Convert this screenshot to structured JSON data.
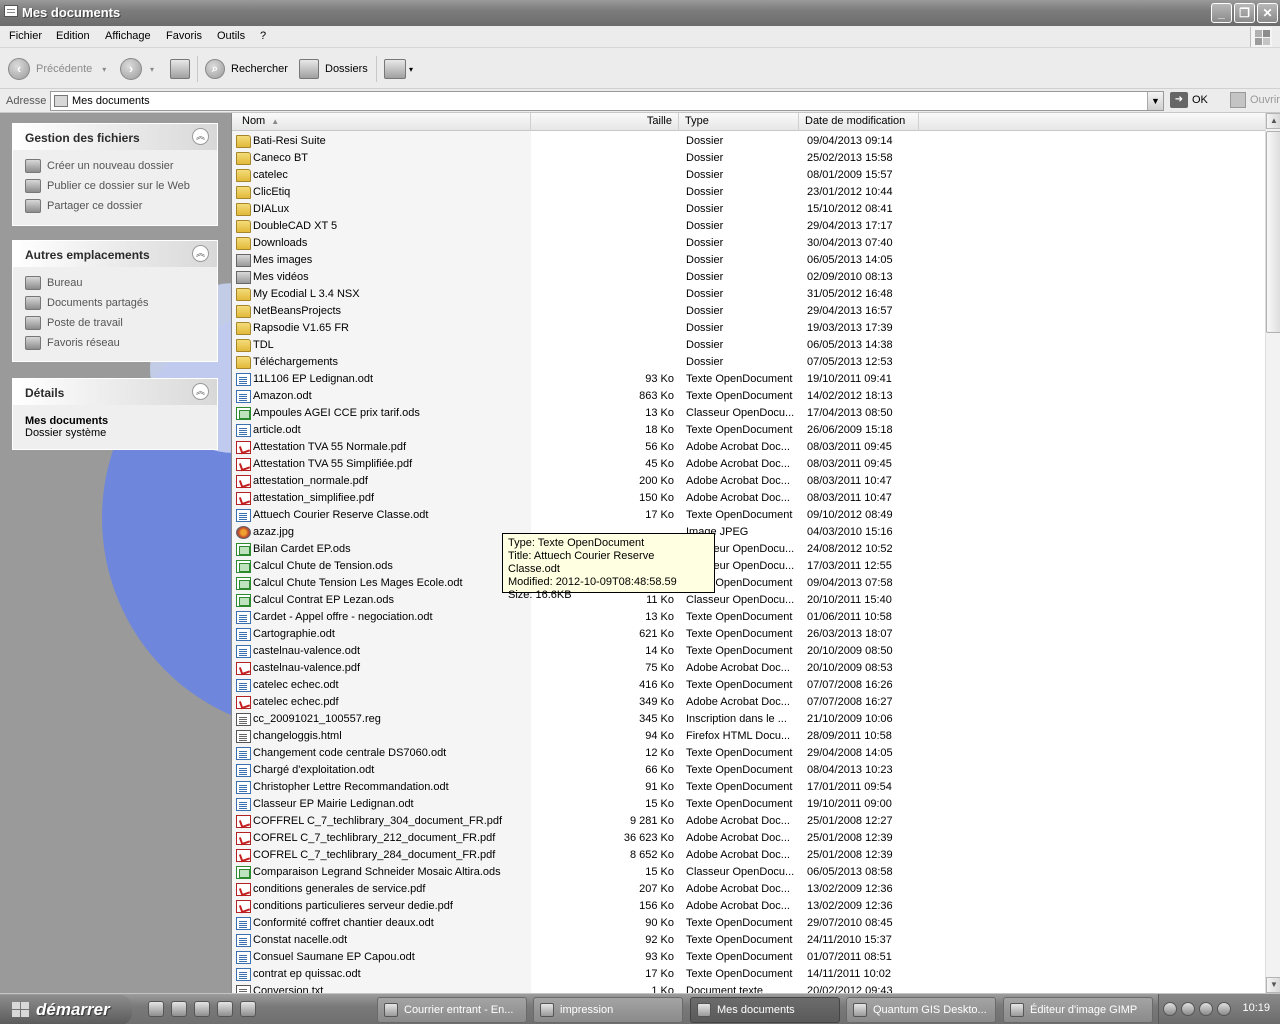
{
  "window": {
    "title": "Mes documents"
  },
  "menu": [
    "Fichier",
    "Edition",
    "Affichage",
    "Favoris",
    "Outils",
    "?"
  ],
  "toolbar": {
    "back": "Précédente",
    "search": "Rechercher",
    "folders": "Dossiers"
  },
  "address": {
    "label": "Adresse",
    "value": "Mes documents",
    "go": "OK",
    "open": "Ouvrir"
  },
  "left_panels": {
    "file_tasks": {
      "title": "Gestion des fichiers",
      "links": [
        "Créer un nouveau dossier",
        "Publier ce dossier sur le Web",
        "Partager ce dossier"
      ]
    },
    "other_places": {
      "title": "Autres emplacements",
      "links": [
        "Bureau",
        "Documents partagés",
        "Poste de travail",
        "Favoris réseau"
      ]
    },
    "details": {
      "title": "Détails",
      "name": "Mes documents",
      "desc": "Dossier système"
    }
  },
  "columns": {
    "name": "Nom",
    "size": "Taille",
    "type": "Type",
    "date": "Date de modification"
  },
  "files": [
    {
      "icon": "folder-icon",
      "name": "Bati-Resi Suite",
      "size": "",
      "type": "Dossier",
      "date": "09/04/2013 09:14"
    },
    {
      "icon": "folder-icon",
      "name": "Caneco BT",
      "size": "",
      "type": "Dossier",
      "date": "25/02/2013 15:58"
    },
    {
      "icon": "folder-icon",
      "name": "catelec",
      "size": "",
      "type": "Dossier",
      "date": "08/01/2009 15:57"
    },
    {
      "icon": "folder-icon",
      "name": "ClicEtiq",
      "size": "",
      "type": "Dossier",
      "date": "23/01/2012 10:44"
    },
    {
      "icon": "folder-icon",
      "name": "DIALux",
      "size": "",
      "type": "Dossier",
      "date": "15/10/2012 08:41"
    },
    {
      "icon": "folder-icon",
      "name": "DoubleCAD XT 5",
      "size": "",
      "type": "Dossier",
      "date": "29/04/2013 17:17"
    },
    {
      "icon": "folder-icon",
      "name": "Downloads",
      "size": "",
      "type": "Dossier",
      "date": "30/04/2013 07:40"
    },
    {
      "icon": "pictures-folder-icon",
      "name": "Mes images",
      "size": "",
      "type": "Dossier",
      "date": "06/05/2013 14:05"
    },
    {
      "icon": "videos-folder-icon",
      "name": "Mes vidéos",
      "size": "",
      "type": "Dossier",
      "date": "02/09/2010 08:13"
    },
    {
      "icon": "folder-icon",
      "name": "My Ecodial L 3.4 NSX",
      "size": "",
      "type": "Dossier",
      "date": "31/05/2012 16:48"
    },
    {
      "icon": "folder-icon",
      "name": "NetBeansProjects",
      "size": "",
      "type": "Dossier",
      "date": "29/04/2013 16:57"
    },
    {
      "icon": "folder-icon",
      "name": "Rapsodie V1.65 FR",
      "size": "",
      "type": "Dossier",
      "date": "19/03/2013 17:39"
    },
    {
      "icon": "folder-icon",
      "name": "TDL",
      "size": "",
      "type": "Dossier",
      "date": "06/05/2013 14:38"
    },
    {
      "icon": "folder-icon",
      "name": "Téléchargements",
      "size": "",
      "type": "Dossier",
      "date": "07/05/2013 12:53"
    },
    {
      "icon": "odt-icon",
      "name": "11L106 EP Ledignan.odt",
      "size": "93 Ko",
      "type": "Texte OpenDocument",
      "date": "19/10/2011 09:41"
    },
    {
      "icon": "odt-icon",
      "name": "Amazon.odt",
      "size": "863 Ko",
      "type": "Texte OpenDocument",
      "date": "14/02/2012 18:13"
    },
    {
      "icon": "ods-icon",
      "name": "Ampoules AGEI CCE prix tarif.ods",
      "size": "13 Ko",
      "type": "Classeur OpenDocu...",
      "date": "17/04/2013 08:50"
    },
    {
      "icon": "odt-icon",
      "name": "article.odt",
      "size": "18 Ko",
      "type": "Texte OpenDocument",
      "date": "26/06/2009 15:18"
    },
    {
      "icon": "pdf-icon",
      "name": "Attestation TVA 55 Normale.pdf",
      "size": "56 Ko",
      "type": "Adobe Acrobat Doc...",
      "date": "08/03/2011 09:45"
    },
    {
      "icon": "pdf-icon",
      "name": "Attestation TVA 55 Simplifiée.pdf",
      "size": "45 Ko",
      "type": "Adobe Acrobat Doc...",
      "date": "08/03/2011 09:45"
    },
    {
      "icon": "pdf-icon",
      "name": "attestation_normale.pdf",
      "size": "200 Ko",
      "type": "Adobe Acrobat Doc...",
      "date": "08/03/2011 10:47"
    },
    {
      "icon": "pdf-icon",
      "name": "attestation_simplifiee.pdf",
      "size": "150 Ko",
      "type": "Adobe Acrobat Doc...",
      "date": "08/03/2011 10:47"
    },
    {
      "icon": "odt-icon",
      "name": "Attuech Courier Reserve Classe.odt",
      "size": "17 Ko",
      "type": "Texte OpenDocument",
      "date": "09/10/2012 08:49"
    },
    {
      "icon": "jpeg-icon",
      "name": "azaz.jpg",
      "size": "",
      "type": "Image JPEG",
      "date": "04/03/2010 15:16"
    },
    {
      "icon": "ods-icon",
      "name": "Bilan Cardet EP.ods",
      "size": "",
      "type": "Classeur OpenDocu...",
      "date": "24/08/2012 10:52"
    },
    {
      "icon": "ods-icon",
      "name": "Calcul Chute de Tension.ods",
      "size": "",
      "type": "Classeur OpenDocu...",
      "date": "17/03/2011 12:55"
    },
    {
      "icon": "ods-icon",
      "name": "Calcul Chute Tension Les Mages Ecole.odt",
      "size": "",
      "type": "Texte OpenDocument",
      "date": "09/04/2013 07:58"
    },
    {
      "icon": "ods-icon",
      "name": "Calcul Contrat EP Lezan.ods",
      "size": "11 Ko",
      "type": "Classeur OpenDocu...",
      "date": "20/10/2011 15:40"
    },
    {
      "icon": "odt-icon",
      "name": "Cardet - Appel offre - negociation.odt",
      "size": "13 Ko",
      "type": "Texte OpenDocument",
      "date": "01/06/2011 10:58"
    },
    {
      "icon": "odt-icon",
      "name": "Cartographie.odt",
      "size": "621 Ko",
      "type": "Texte OpenDocument",
      "date": "26/03/2013 18:07"
    },
    {
      "icon": "odt-icon",
      "name": "castelnau-valence.odt",
      "size": "14 Ko",
      "type": "Texte OpenDocument",
      "date": "20/10/2009 08:50"
    },
    {
      "icon": "pdf-icon",
      "name": "castelnau-valence.pdf",
      "size": "75 Ko",
      "type": "Adobe Acrobat Doc...",
      "date": "20/10/2009 08:53"
    },
    {
      "icon": "odt-icon",
      "name": "catelec echec.odt",
      "size": "416 Ko",
      "type": "Texte OpenDocument",
      "date": "07/07/2008 16:26"
    },
    {
      "icon": "pdf-icon",
      "name": "catelec echec.pdf",
      "size": "349 Ko",
      "type": "Adobe Acrobat Doc...",
      "date": "07/07/2008 16:27"
    },
    {
      "icon": "reg-icon",
      "name": "cc_20091021_100557.reg",
      "size": "345 Ko",
      "type": "Inscription dans le ...",
      "date": "21/10/2009 10:06"
    },
    {
      "icon": "html-icon",
      "name": "changeloggis.html",
      "size": "94 Ko",
      "type": "Firefox HTML Docu...",
      "date": "28/09/2011 10:58"
    },
    {
      "icon": "odt-icon",
      "name": "Changement code centrale DS7060.odt",
      "size": "12 Ko",
      "type": "Texte OpenDocument",
      "date": "29/04/2008 14:05"
    },
    {
      "icon": "odt-icon",
      "name": "Chargé d'exploitation.odt",
      "size": "66 Ko",
      "type": "Texte OpenDocument",
      "date": "08/04/2013 10:23"
    },
    {
      "icon": "odt-icon",
      "name": "Christopher Lettre Recommandation.odt",
      "size": "91 Ko",
      "type": "Texte OpenDocument",
      "date": "17/01/2011 09:54"
    },
    {
      "icon": "odt-icon",
      "name": "Classeur EP Mairie Ledignan.odt",
      "size": "15 Ko",
      "type": "Texte OpenDocument",
      "date": "19/10/2011 09:00"
    },
    {
      "icon": "pdf-icon",
      "name": "COFFREL C_7_techlibrary_304_document_FR.pdf",
      "size": "9 281 Ko",
      "type": "Adobe Acrobat Doc...",
      "date": "25/01/2008 12:27"
    },
    {
      "icon": "pdf-icon",
      "name": "COFREL C_7_techlibrary_212_document_FR.pdf",
      "size": "36 623 Ko",
      "type": "Adobe Acrobat Doc...",
      "date": "25/01/2008 12:39"
    },
    {
      "icon": "pdf-icon",
      "name": "COFREL C_7_techlibrary_284_document_FR.pdf",
      "size": "8 652 Ko",
      "type": "Adobe Acrobat Doc...",
      "date": "25/01/2008 12:39"
    },
    {
      "icon": "ods-icon",
      "name": "Comparaison Legrand Schneider Mosaic Altira.ods",
      "size": "15 Ko",
      "type": "Classeur OpenDocu...",
      "date": "06/05/2013 08:58"
    },
    {
      "icon": "pdf-icon",
      "name": "conditions generales de service.pdf",
      "size": "207 Ko",
      "type": "Adobe Acrobat Doc...",
      "date": "13/02/2009 12:36"
    },
    {
      "icon": "pdf-icon",
      "name": "conditions particulieres serveur dedie.pdf",
      "size": "156 Ko",
      "type": "Adobe Acrobat Doc...",
      "date": "13/02/2009 12:36"
    },
    {
      "icon": "odt-icon",
      "name": "Conformité coffret chantier deaux.odt",
      "size": "90 Ko",
      "type": "Texte OpenDocument",
      "date": "29/07/2010 08:45"
    },
    {
      "icon": "odt-icon",
      "name": "Constat nacelle.odt",
      "size": "92 Ko",
      "type": "Texte OpenDocument",
      "date": "24/11/2010 15:37"
    },
    {
      "icon": "odt-icon",
      "name": "Consuel Saumane EP Capou.odt",
      "size": "93 Ko",
      "type": "Texte OpenDocument",
      "date": "01/07/2011 08:51"
    },
    {
      "icon": "odt-icon",
      "name": "contrat ep quissac.odt",
      "size": "17 Ko",
      "type": "Texte OpenDocument",
      "date": "14/11/2011 10:02"
    },
    {
      "icon": "txt-icon",
      "name": "Conversion.txt",
      "size": "1 Ko",
      "type": "Document texte",
      "date": "20/02/2012 09:43"
    }
  ],
  "tooltip": [
    "Type: Texte OpenDocument",
    "Title: Attuech Courier Reserve Classe.odt",
    "Modified: 2012-10-09T08:48:58.59",
    "Size: 16.6KB"
  ],
  "taskbar": {
    "start": "démarrer",
    "buttons": [
      "Courrier entrant - En...",
      "impression",
      "Mes documents",
      "Quantum GIS Deskto...",
      "Éditeur d'image GIMP"
    ],
    "active": 2,
    "clock": "10:19"
  }
}
